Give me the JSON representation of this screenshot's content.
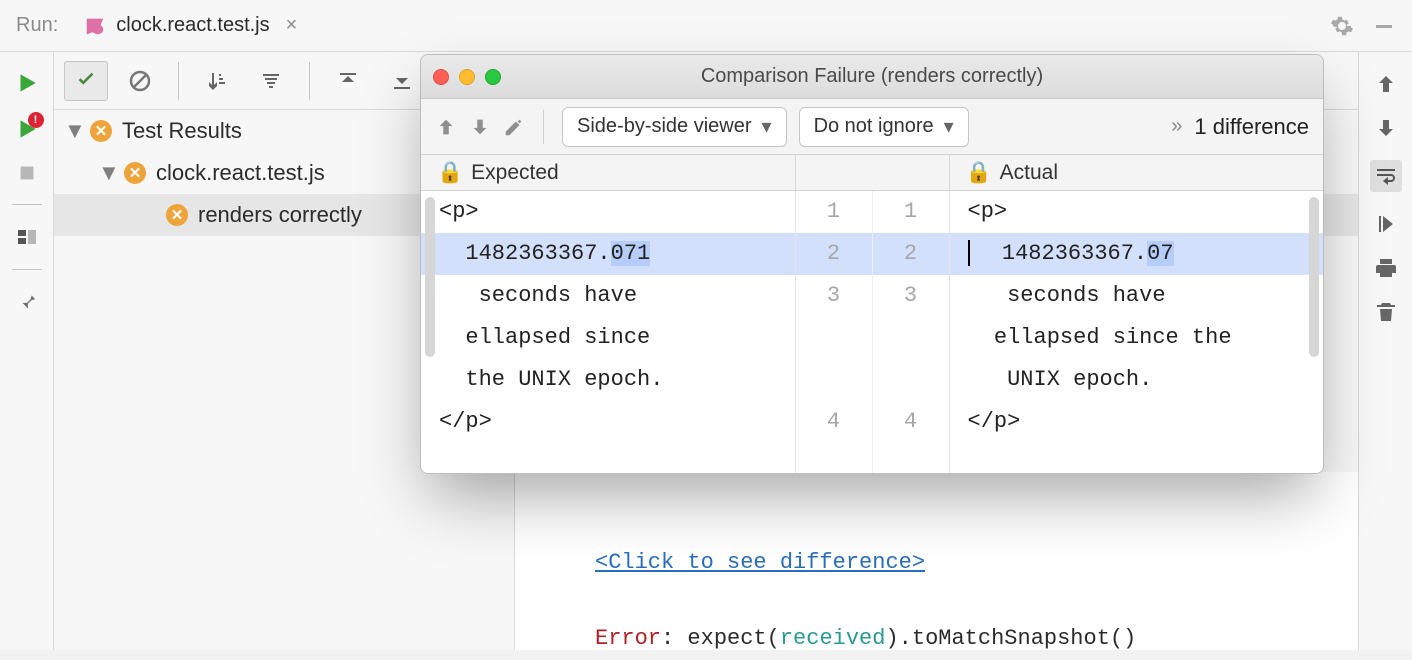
{
  "runbar": {
    "label": "Run:",
    "tab_title": "clock.react.test.js"
  },
  "tree": {
    "root": "Test Results",
    "file": "clock.react.test.js",
    "test": "renders correctly"
  },
  "console": {
    "link_text": "<Click to see difference>",
    "error_kw": "Error",
    "before_rec": ": expect(",
    "received": "received",
    "after_rec": ").toMatchSnapshot()"
  },
  "dialog": {
    "title": "Comparison Failure (renders correctly)",
    "viewer_mode": "Side-by-side viewer",
    "ignore_mode": "Do not ignore",
    "diff_count": "1 difference",
    "expected_label": "Expected",
    "actual_label": "Actual",
    "gutters": {
      "left": [
        "1",
        "2",
        "3",
        "",
        "4"
      ],
      "right": [
        "1",
        "2",
        "3",
        "",
        "4"
      ]
    },
    "expected": {
      "l1": "<p>",
      "l2_a": "  1482363367.",
      "l2_b": "071",
      "l3": "   seconds have",
      "l4": "  ellapsed since",
      "l5": "  the UNIX epoch.",
      "l6": "</p>"
    },
    "actual": {
      "l1": "<p>",
      "l2_a": "  1482363367.",
      "l2_b": "07",
      "l3": "   seconds have",
      "l4": "  ellapsed since the",
      "l5": "   UNIX epoch.",
      "l6": "</p>"
    }
  }
}
